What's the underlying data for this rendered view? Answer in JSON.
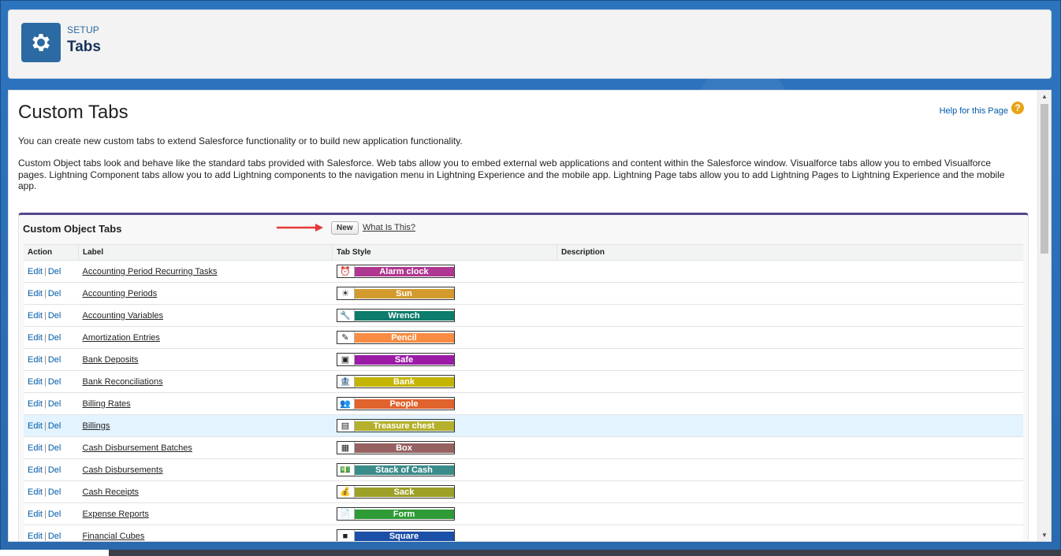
{
  "header": {
    "setup_label": "SETUP",
    "title": "Tabs",
    "icon": "gear-icon"
  },
  "content": {
    "heading": "Custom Tabs",
    "help_link": "Help for this Page",
    "help_icon": "?",
    "intro_1": "You can create new custom tabs to extend Salesforce functionality or to build new application functionality.",
    "intro_2": "Custom Object tabs look and behave like the standard tabs provided with Salesforce. Web tabs allow you to embed external web applications and content within the Salesforce window. Visualforce tabs allow you to embed Visualforce pages. Lightning Component tabs allow you to add Lightning components to the navigation menu in Lightning Experience and the mobile app. Lightning Page tabs allow you to add Lightning Pages to Lightning Experience and the mobile app."
  },
  "section": {
    "title": "Custom Object Tabs",
    "new_button": "New",
    "what_link": "What Is This?"
  },
  "table": {
    "headers": [
      "Action",
      "Label",
      "Tab Style",
      "Description"
    ],
    "edit_label": "Edit",
    "del_label": "Del",
    "separator": "|",
    "rows": [
      {
        "label": "Accounting Period Recurring Tasks",
        "style": "Alarm clock",
        "color": "#b03791",
        "icon": "alarm-clock-icon",
        "glyph": "⏰",
        "highlight": false
      },
      {
        "label": "Accounting Periods",
        "style": "Sun",
        "color": "#d39a2e",
        "icon": "sun-icon",
        "glyph": "☀",
        "highlight": false
      },
      {
        "label": "Accounting Variables",
        "style": "Wrench",
        "color": "#0d7c6c",
        "icon": "wrench-icon",
        "glyph": "🔧",
        "highlight": false
      },
      {
        "label": "Amortization Entries",
        "style": "Pencil",
        "color": "#f98c42",
        "icon": "pencil-icon",
        "glyph": "✎",
        "highlight": false
      },
      {
        "label": "Bank Deposits",
        "style": "Safe",
        "color": "#9b1aa6",
        "icon": "safe-icon",
        "glyph": "▣",
        "highlight": false
      },
      {
        "label": "Bank Reconciliations",
        "style": "Bank",
        "color": "#c4b402",
        "icon": "bank-icon",
        "glyph": "🏦",
        "highlight": false
      },
      {
        "label": "Billing Rates",
        "style": "People",
        "color": "#e0622c",
        "icon": "people-icon",
        "glyph": "👥",
        "highlight": false
      },
      {
        "label": "Billings",
        "style": "Treasure chest",
        "color": "#b5b02b",
        "icon": "treasure-chest-icon",
        "glyph": "▤",
        "highlight": true
      },
      {
        "label": "Cash Disbursement Batches",
        "style": "Box",
        "color": "#956161",
        "icon": "box-icon",
        "glyph": "▦",
        "highlight": false
      },
      {
        "label": "Cash Disbursements",
        "style": "Stack of Cash",
        "color": "#3a8c8a",
        "icon": "stack-of-cash-icon",
        "glyph": "💵",
        "highlight": false
      },
      {
        "label": "Cash Receipts",
        "style": "Sack",
        "color": "#9da026",
        "icon": "sack-icon",
        "glyph": "💰",
        "highlight": false
      },
      {
        "label": "Expense Reports",
        "style": "Form",
        "color": "#2e9b36",
        "icon": "form-icon",
        "glyph": "📄",
        "highlight": false
      },
      {
        "label": "Financial Cubes",
        "style": "Square",
        "color": "#1c4fa8",
        "icon": "square-icon",
        "glyph": "■",
        "highlight": false
      }
    ]
  },
  "colors": {
    "accent": "#56458c",
    "link": "#015ba7",
    "header_icon_bg": "#2b6aa2",
    "arrow": "#e53935"
  }
}
